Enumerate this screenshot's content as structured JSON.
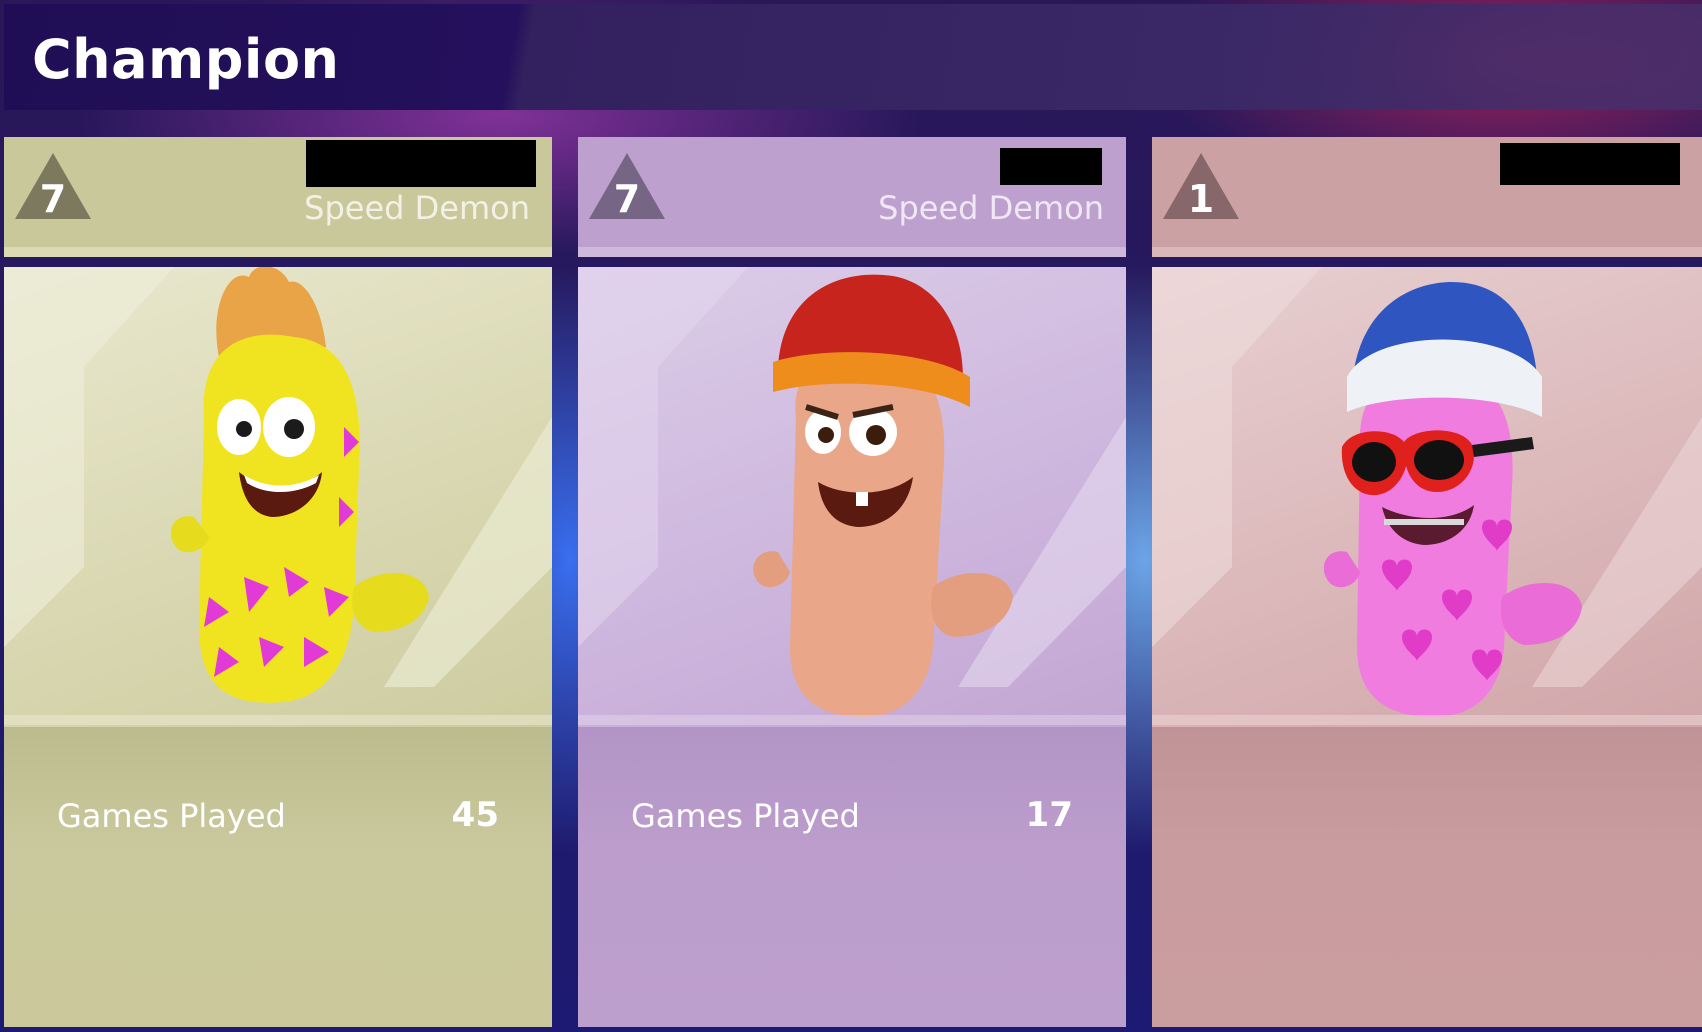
{
  "header": {
    "title": "Champion"
  },
  "cards": [
    {
      "rank": "7",
      "subtitle": "Speed Demon",
      "stat_label": "Games Played",
      "stat_value": "45",
      "character": "yellow-worm-mohawk"
    },
    {
      "rank": "7",
      "subtitle": "Speed Demon",
      "stat_label": "Games Played",
      "stat_value": "17",
      "character": "pink-worm-orange-beanie"
    },
    {
      "rank": "1",
      "character": "pink-heart-worm-sunglasses"
    }
  ],
  "colors": {
    "card_1": "#c9c89b",
    "card_2": "#bea0cf",
    "card_3": "#cca1a4",
    "header": "#1f0e55"
  }
}
